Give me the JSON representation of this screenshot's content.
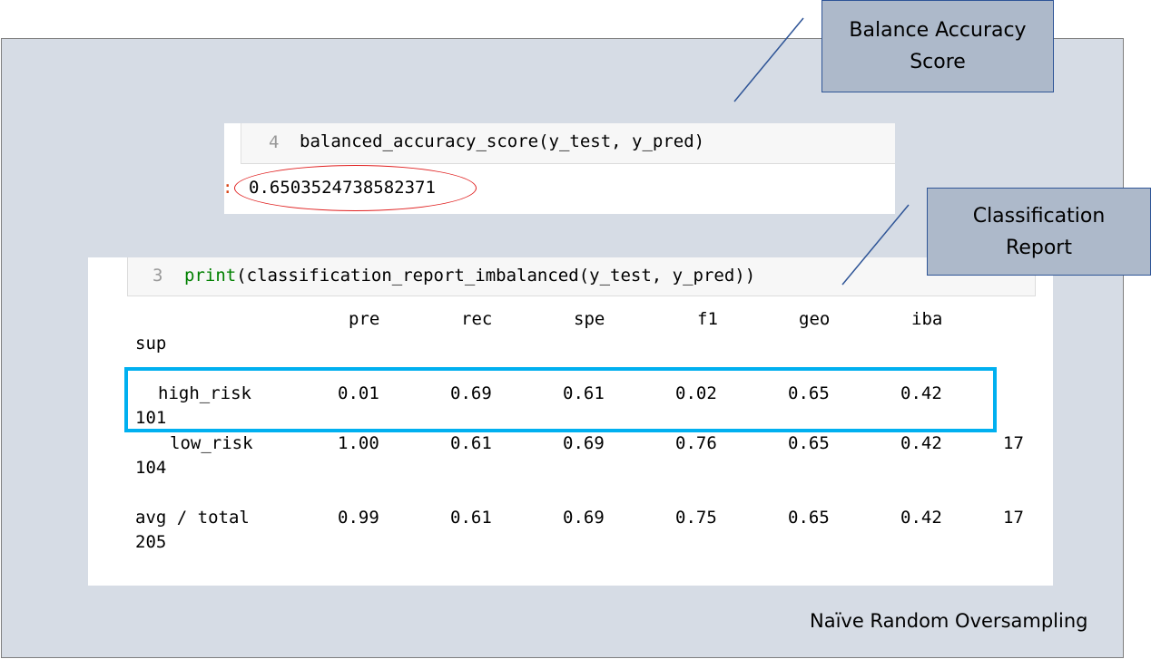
{
  "callouts": {
    "balance_accuracy": "Balance Accuracy Score",
    "classification_report": "Classification Report"
  },
  "accuracy_cell": {
    "line_number": "4",
    "code": "balanced_accuracy_score(y_test, y_pred)",
    "output_prompt": ":",
    "output_value": "0.6503524738582371"
  },
  "report_cell": {
    "line_number": "3",
    "code_keyword": "print",
    "code_rest": "(classification_report_imbalanced(y_test, y_pred))"
  },
  "report": {
    "headers": [
      "pre",
      "rec",
      "spe",
      "f1",
      "geo",
      "iba",
      "sup"
    ],
    "rows": [
      {
        "label": "high_risk",
        "values": [
          "0.01",
          "0.69",
          "0.61",
          "0.02",
          "0.65",
          "0.42"
        ],
        "sup": "101"
      },
      {
        "label": "low_risk",
        "values": [
          "1.00",
          "0.61",
          "0.69",
          "0.76",
          "0.65",
          "0.42"
        ],
        "trail": "17",
        "sup": "104"
      },
      {
        "label": "avg / total",
        "values": [
          "0.99",
          "0.61",
          "0.69",
          "0.75",
          "0.65",
          "0.42"
        ],
        "trail": "17",
        "sup": "205"
      }
    ]
  },
  "footer_label": "Naïve Random Oversampling",
  "colors": {
    "slide_background": "#d6dce5",
    "callout_fill": "#adb9ca",
    "callout_border": "#2f5597",
    "ellipse": "#e02020",
    "highlight": "#00b0f0",
    "print_keyword": "#008000"
  }
}
